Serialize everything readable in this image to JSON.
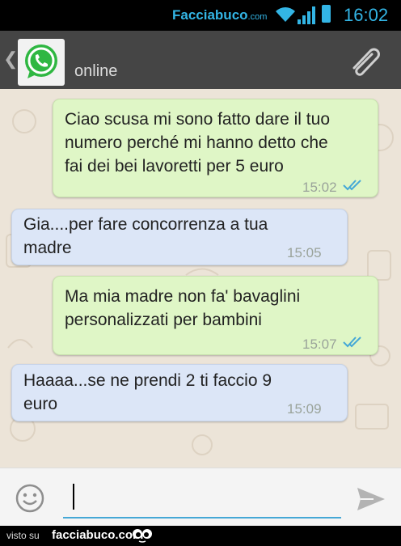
{
  "status_bar": {
    "brand_main": "Facciabuco",
    "brand_suffix": ".com",
    "time": "16:02"
  },
  "header": {
    "status": "online"
  },
  "messages": [
    {
      "direction": "outgoing",
      "text": "Ciao scusa mi sono fatto dare il tuo\nnumero perché mi hanno detto che\nfai dei bei lavoretti per 5 euro",
      "time": "15:02",
      "read": true
    },
    {
      "direction": "incoming",
      "text": "Gia....per fare concorrenza a tua\nmadre",
      "time": "15:05"
    },
    {
      "direction": "outgoing",
      "text": "Ma mia madre non fa' bavaglini\npersonalizzati per bambini",
      "time": "15:07",
      "read": true
    },
    {
      "direction": "incoming",
      "text": "Haaaa...se ne prendi 2 ti faccio 9\neuro",
      "time": "15:09"
    }
  ],
  "composer": {
    "value": ""
  },
  "footer": {
    "prefix": "visto su",
    "brand": "facciabuco.com"
  },
  "colors": {
    "accent": "#33b5e5",
    "header_bg": "#454545",
    "outgoing_bubble": "#dff6c6",
    "incoming_bubble": "#dce6f7",
    "chat_bg": "#ece4d8",
    "read_ticks": "#45a8d6"
  }
}
